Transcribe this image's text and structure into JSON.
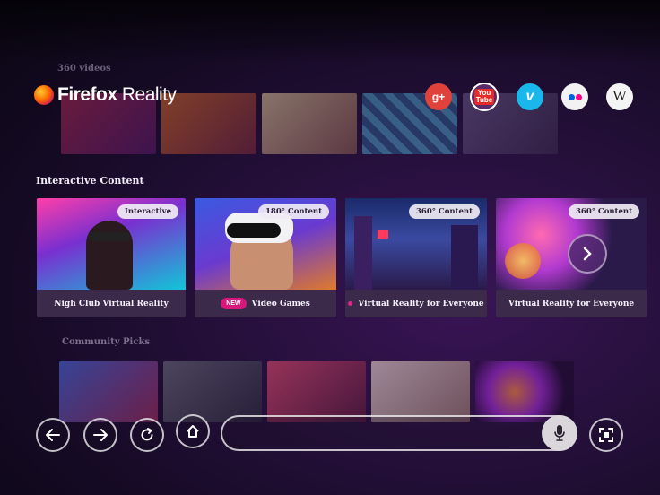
{
  "background_sections": {
    "top_label": "360 videos",
    "community_label": "Community Picks"
  },
  "brand": {
    "name_bold": "Firefox",
    "name_light": " Reality"
  },
  "social": [
    {
      "name": "google-plus",
      "label": "g+",
      "color": "#e0413a"
    },
    {
      "name": "youtube",
      "label": "You\nTube",
      "color": "#e52d27"
    },
    {
      "name": "vimeo",
      "label": "v",
      "color": "#1ab7ea"
    },
    {
      "name": "flickr",
      "label": "••",
      "color": "#f2f2f2"
    },
    {
      "name": "wikipedia",
      "label": "W",
      "color": "#f4f4f4"
    }
  ],
  "interactive": {
    "title": "Interactive Content",
    "cards": [
      {
        "badge": "Interactive",
        "caption": "Nigh Club Virtual Reality"
      },
      {
        "badge": "180° Content",
        "new_label": "NEW",
        "caption": "Video Games"
      },
      {
        "badge": "360° Content",
        "caption": "Virtual Reality for Everyone"
      },
      {
        "badge": "360° Content",
        "caption": "Virtual Reality for Everyone"
      }
    ]
  },
  "icons": {
    "back": "back-arrow-icon",
    "forward": "forward-arrow-icon",
    "reload": "reload-icon",
    "home": "home-icon",
    "mic": "microphone-icon",
    "fullscreen": "fullscreen-icon",
    "next": "chevron-right-icon"
  },
  "url_bar": {
    "value": "",
    "placeholder": ""
  }
}
